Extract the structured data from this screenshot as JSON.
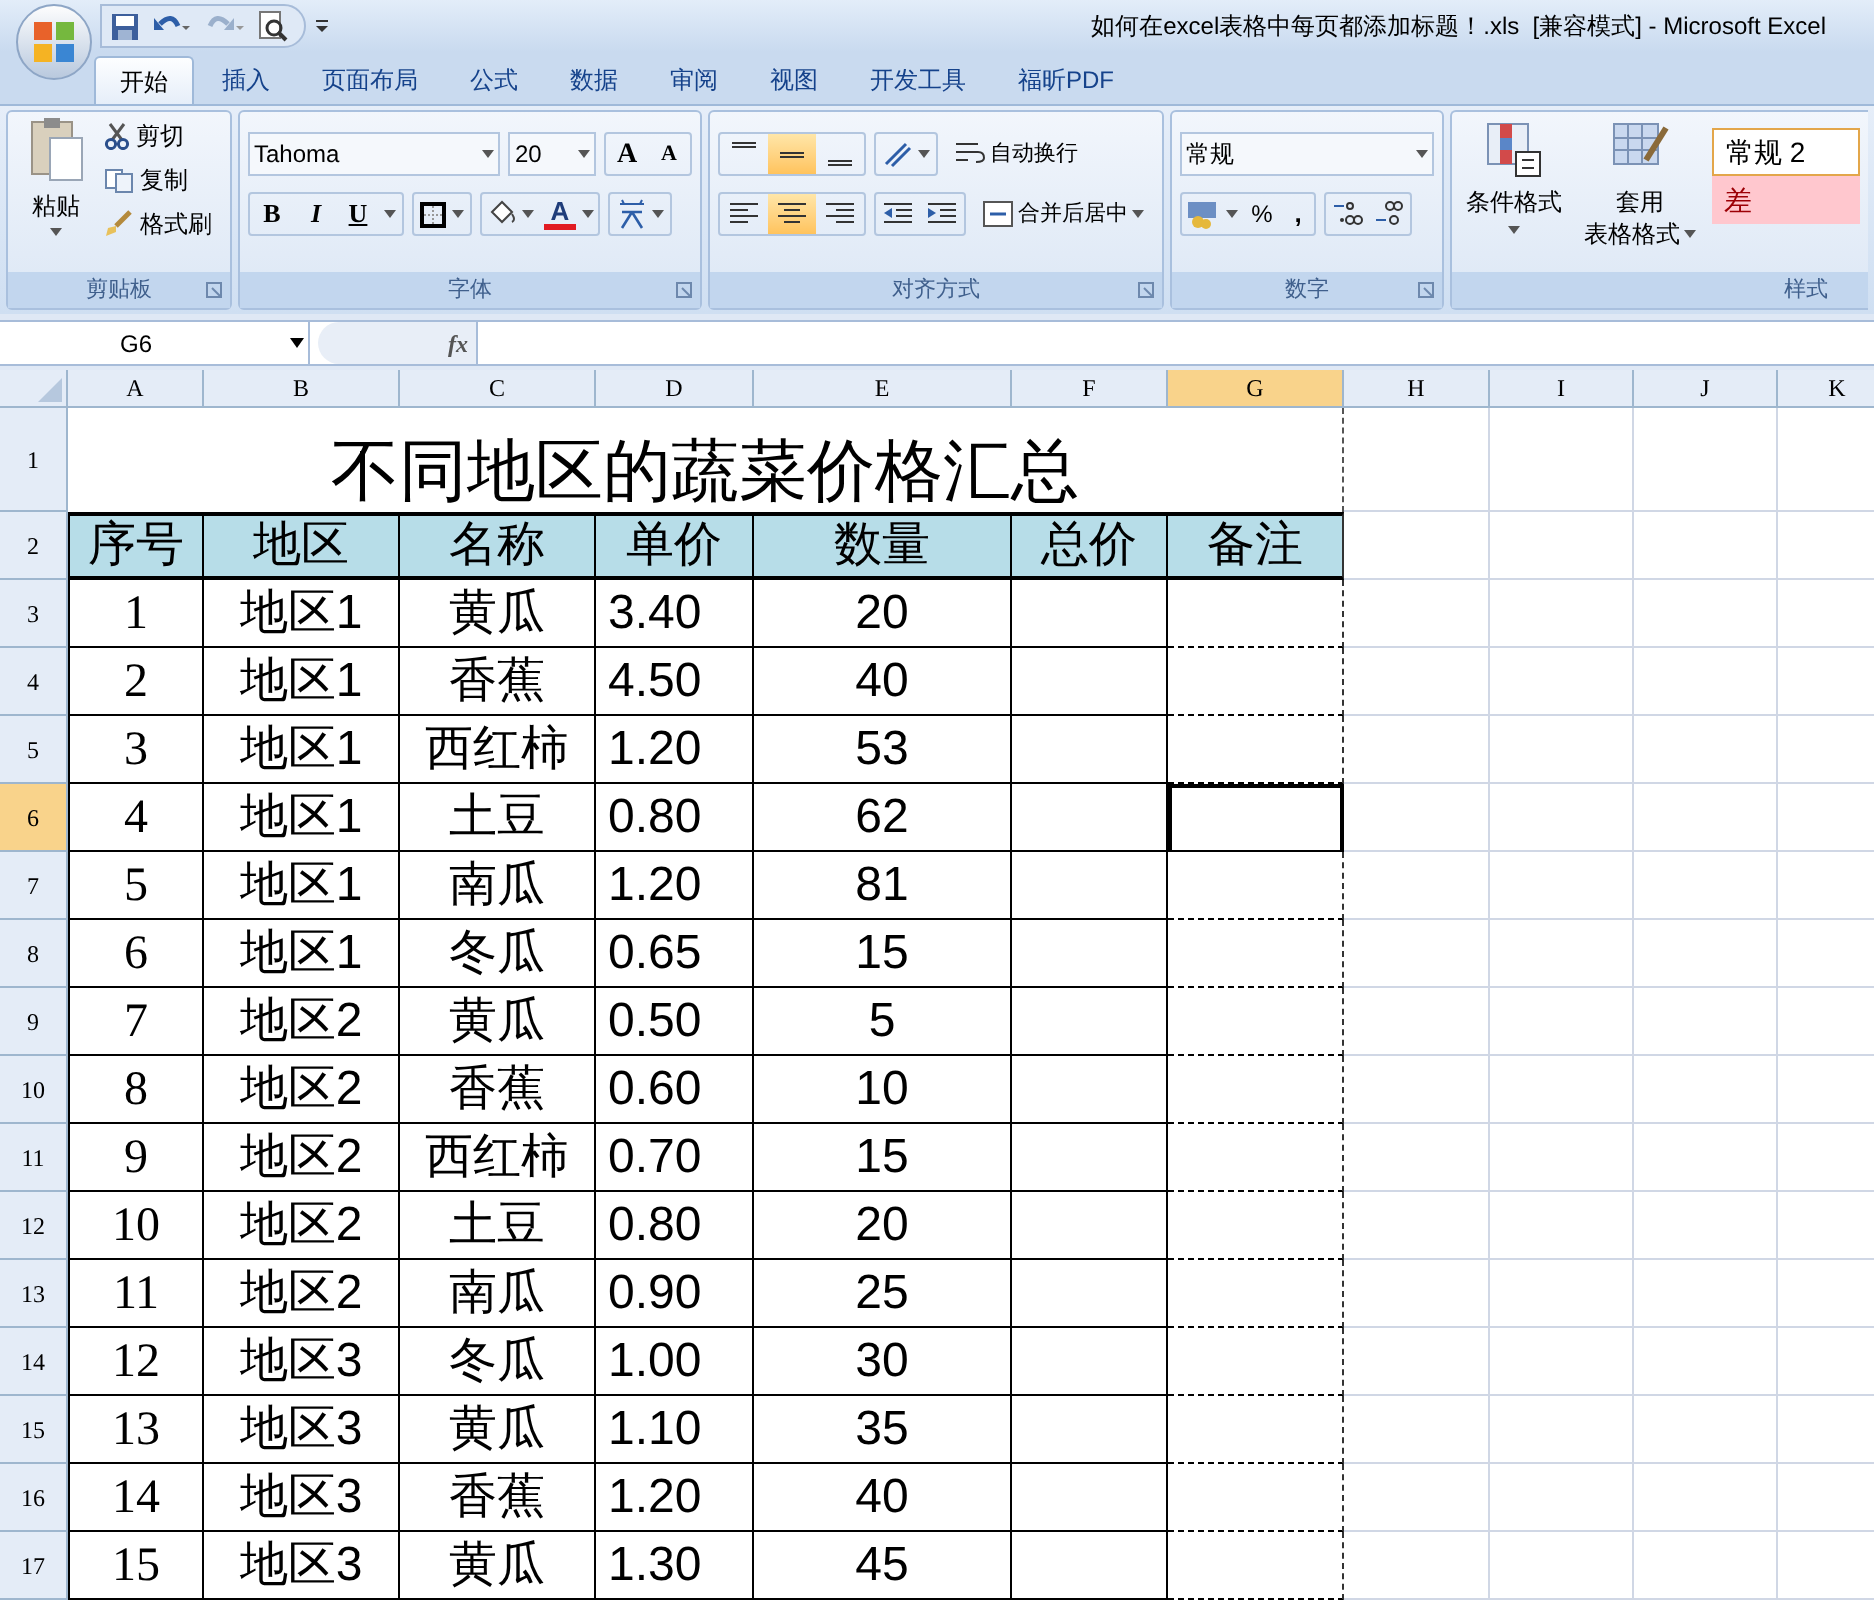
{
  "window": {
    "title": "如何在excel表格中每页都添加标题！.xls  [兼容模式] - Microsoft Excel"
  },
  "ribbon_tabs": [
    {
      "label": "开始",
      "selected": true
    },
    {
      "label": "插入",
      "selected": false
    },
    {
      "label": "页面布局",
      "selected": false
    },
    {
      "label": "公式",
      "selected": false
    },
    {
      "label": "数据",
      "selected": false
    },
    {
      "label": "审阅",
      "selected": false
    },
    {
      "label": "视图",
      "selected": false
    },
    {
      "label": "开发工具",
      "selected": false
    },
    {
      "label": "福昕PDF",
      "selected": false
    }
  ],
  "clipboard": {
    "paste": "粘贴",
    "cut": "剪切",
    "copy": "复制",
    "format_painter": "格式刷",
    "label": "剪贴板"
  },
  "font": {
    "font_name": "Tahoma",
    "font_size": "20",
    "grow": "A",
    "shrink": "A",
    "bold": "B",
    "italic": "I",
    "underline": "U",
    "font_color": "A",
    "label": "字体"
  },
  "alignment": {
    "vertical": [
      {
        "selected": false
      },
      {
        "selected": true
      },
      {
        "selected": false
      }
    ],
    "horizontal": [
      {
        "selected": false
      },
      {
        "selected": true
      },
      {
        "selected": false
      }
    ],
    "wrap_text": "自动换行",
    "merge_center": "合并后居中",
    "label": "对齐方式"
  },
  "number": {
    "format": "常规",
    "percent": "%",
    "comma": ",",
    "label": "数字"
  },
  "styles": {
    "conditional_format": "条件格式",
    "table_format_1": "套用",
    "table_format_2": "表格格式",
    "cell_styles": [
      {
        "label": "常规 2",
        "kind": "normal"
      },
      {
        "label": "差",
        "kind": "bad"
      }
    ],
    "label": "样式"
  },
  "formula_bar": {
    "name_box": "G6",
    "function_label": "fx"
  },
  "sheet": {
    "columns": [
      {
        "label": "A",
        "selected": false
      },
      {
        "label": "B",
        "selected": false
      },
      {
        "label": "C",
        "selected": false
      },
      {
        "label": "D",
        "selected": false
      },
      {
        "label": "E",
        "selected": false
      },
      {
        "label": "F",
        "selected": false
      },
      {
        "label": "G",
        "selected": true
      },
      {
        "label": "H",
        "selected": false
      },
      {
        "label": "I",
        "selected": false
      },
      {
        "label": "J",
        "selected": false
      },
      {
        "label": "K",
        "selected": false
      }
    ],
    "title_row": {
      "number": "1",
      "selected": false,
      "title": "不同地区的蔬菜价格汇总"
    },
    "header_row": {
      "number": "2",
      "selected": false,
      "cells": [
        "序号",
        "地区",
        "名称",
        "单价",
        "数量",
        "总价",
        "备注"
      ]
    },
    "rows": [
      {
        "number": "3",
        "selected": false,
        "remark_selected": false,
        "cells": [
          "1",
          "地区1",
          "黄瓜",
          "3.40",
          "20"
        ]
      },
      {
        "number": "4",
        "selected": false,
        "remark_selected": false,
        "cells": [
          "2",
          "地区1",
          "香蕉",
          "4.50",
          "40"
        ]
      },
      {
        "number": "5",
        "selected": false,
        "remark_selected": false,
        "cells": [
          "3",
          "地区1",
          "西红柿",
          "1.20",
          "53"
        ]
      },
      {
        "number": "6",
        "selected": true,
        "remark_selected": true,
        "cells": [
          "4",
          "地区1",
          "土豆",
          "0.80",
          "62"
        ]
      },
      {
        "number": "7",
        "selected": false,
        "remark_selected": false,
        "cells": [
          "5",
          "地区1",
          "南瓜",
          "1.20",
          "81"
        ]
      },
      {
        "number": "8",
        "selected": false,
        "remark_selected": false,
        "cells": [
          "6",
          "地区1",
          "冬瓜",
          "0.65",
          "15"
        ]
      },
      {
        "number": "9",
        "selected": false,
        "remark_selected": false,
        "cells": [
          "7",
          "地区2",
          "黄瓜",
          "0.50",
          "5"
        ]
      },
      {
        "number": "10",
        "selected": false,
        "remark_selected": false,
        "cells": [
          "8",
          "地区2",
          "香蕉",
          "0.60",
          "10"
        ]
      },
      {
        "number": "11",
        "selected": false,
        "remark_selected": false,
        "cells": [
          "9",
          "地区2",
          "西红柿",
          "0.70",
          "15"
        ]
      },
      {
        "number": "12",
        "selected": false,
        "remark_selected": false,
        "cells": [
          "10",
          "地区2",
          "土豆",
          "0.80",
          "20"
        ]
      },
      {
        "number": "13",
        "selected": false,
        "remark_selected": false,
        "cells": [
          "11",
          "地区2",
          "南瓜",
          "0.90",
          "25"
        ]
      },
      {
        "number": "14",
        "selected": false,
        "remark_selected": false,
        "cells": [
          "12",
          "地区3",
          "冬瓜",
          "1.00",
          "30"
        ]
      },
      {
        "number": "15",
        "selected": false,
        "remark_selected": false,
        "cells": [
          "13",
          "地区3",
          "黄瓜",
          "1.10",
          "35"
        ]
      },
      {
        "number": "16",
        "selected": false,
        "remark_selected": false,
        "cells": [
          "14",
          "地区3",
          "香蕉",
          "1.20",
          "40"
        ]
      },
      {
        "number": "17",
        "selected": false,
        "remark_selected": false,
        "cells": [
          "15",
          "地区3",
          "黄瓜",
          "1.30",
          "45"
        ]
      }
    ]
  }
}
